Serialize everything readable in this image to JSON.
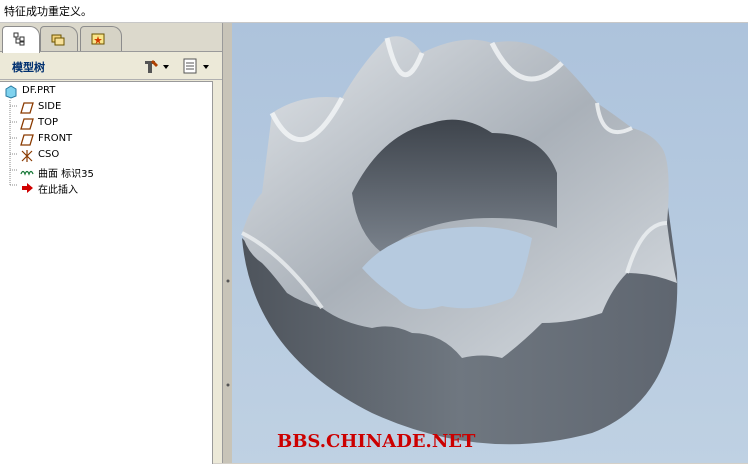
{
  "status_message": "特征成功重定义。",
  "tabs": [
    {
      "icon": "model-tree-tab-icon"
    },
    {
      "icon": "folder-browser-tab-icon"
    },
    {
      "icon": "favorites-tab-icon"
    }
  ],
  "model_tree": {
    "title": "模型树",
    "settings_icon": "tools-icon",
    "show_icon": "list-options-icon",
    "items": [
      {
        "label": "DF.PRT",
        "icon": "part-icon"
      },
      {
        "label": "SIDE",
        "icon": "datum-plane-icon"
      },
      {
        "label": "TOP",
        "icon": "datum-plane-icon"
      },
      {
        "label": "FRONT",
        "icon": "datum-plane-icon"
      },
      {
        "label": "CSO",
        "icon": "coordinate-system-icon"
      },
      {
        "label": "曲面 标识35",
        "icon": "surface-icon"
      },
      {
        "label": "在此插入",
        "icon": "insert-here-arrow-icon"
      }
    ]
  },
  "viewport": {
    "watermark": "BBS.CHINADE.NET",
    "model": "wavy-ring-solid"
  },
  "colors": {
    "viewport_top": "#adc3dc",
    "viewport_bottom": "#bfd1e3",
    "model_shade": "#6d7580",
    "watermark": "#cc0000"
  }
}
